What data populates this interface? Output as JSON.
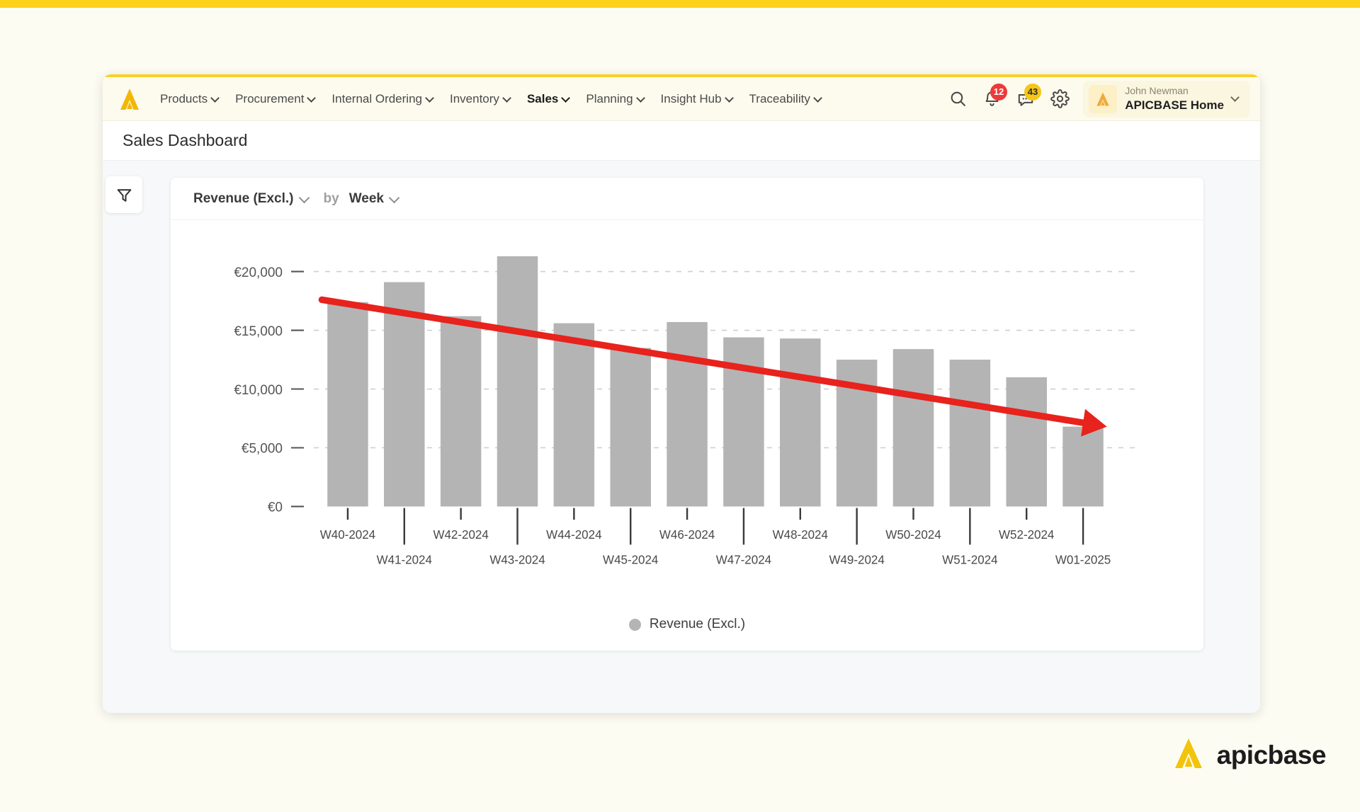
{
  "brand": {
    "name": "apicbase",
    "accent": "#f5c518",
    "logo_icon": "apicbase-logo-icon"
  },
  "navbar": {
    "items": [
      {
        "label": "Products",
        "has_dropdown": true,
        "active": false
      },
      {
        "label": "Procurement",
        "has_dropdown": true,
        "active": false
      },
      {
        "label": "Internal Ordering",
        "has_dropdown": true,
        "active": false
      },
      {
        "label": "Inventory",
        "has_dropdown": true,
        "active": false
      },
      {
        "label": "Sales",
        "has_dropdown": true,
        "active": true
      },
      {
        "label": "Planning",
        "has_dropdown": true,
        "active": false
      },
      {
        "label": "Insight Hub",
        "has_dropdown": true,
        "active": false
      },
      {
        "label": "Traceability",
        "has_dropdown": true,
        "active": false
      }
    ],
    "search_icon": "search-icon",
    "notifications": {
      "icon": "bell-icon",
      "count": "12",
      "color": "#ec3a3a"
    },
    "messages": {
      "icon": "chat-icon",
      "count": "43",
      "color": "#f5c518"
    },
    "settings_icon": "gear-icon",
    "profile": {
      "user_name": "John Newman",
      "organisation": "APICBASE Home",
      "avatar_icon": "apicbase-avatar-icon",
      "chevron": "chevron-down-icon"
    }
  },
  "page": {
    "title": "Sales Dashboard"
  },
  "toolbar": {
    "filter_icon": "filter-icon"
  },
  "chart_card": {
    "metric_selector": "Revenue (Excl.)",
    "by_word": "by",
    "grouping_selector": "Week",
    "metric_chevron": "chevron-down-icon",
    "grouping_chevron": "chevron-down-icon"
  },
  "chart_data": {
    "type": "bar",
    "title": "",
    "xlabel": "",
    "ylabel": "",
    "ylim": [
      0,
      22500
    ],
    "yticks": [
      0,
      5000,
      10000,
      15000,
      20000
    ],
    "ytick_labels": [
      "€0",
      "€5,000",
      "€10,000",
      "€15,000",
      "€20,000"
    ],
    "grid": true,
    "grid_style": "dashed",
    "legend": [
      {
        "name": "Revenue (Excl.)",
        "color": "#b4b4b4"
      }
    ],
    "legend_position": "bottom-center",
    "bar_color": "#b4b4b4",
    "categories": [
      "W40-2024",
      "W41-2024",
      "W42-2024",
      "W43-2024",
      "W44-2024",
      "W45-2024",
      "W46-2024",
      "W47-2024",
      "W48-2024",
      "W49-2024",
      "W50-2024",
      "W51-2024",
      "W52-2024",
      "W01-2025"
    ],
    "series": [
      {
        "name": "Revenue (Excl.)",
        "values": [
          17400,
          19100,
          16200,
          21300,
          15600,
          13500,
          15700,
          14400,
          14300,
          12500,
          13400,
          12500,
          11000,
          6800
        ]
      }
    ],
    "annotations": [
      {
        "type": "trend-arrow",
        "color": "#e8221c",
        "label": "",
        "start": {
          "category": "W40-2024",
          "value": 17600
        },
        "end": {
          "category": "W01-2025",
          "value": 6800
        },
        "direction": "downward"
      }
    ]
  }
}
